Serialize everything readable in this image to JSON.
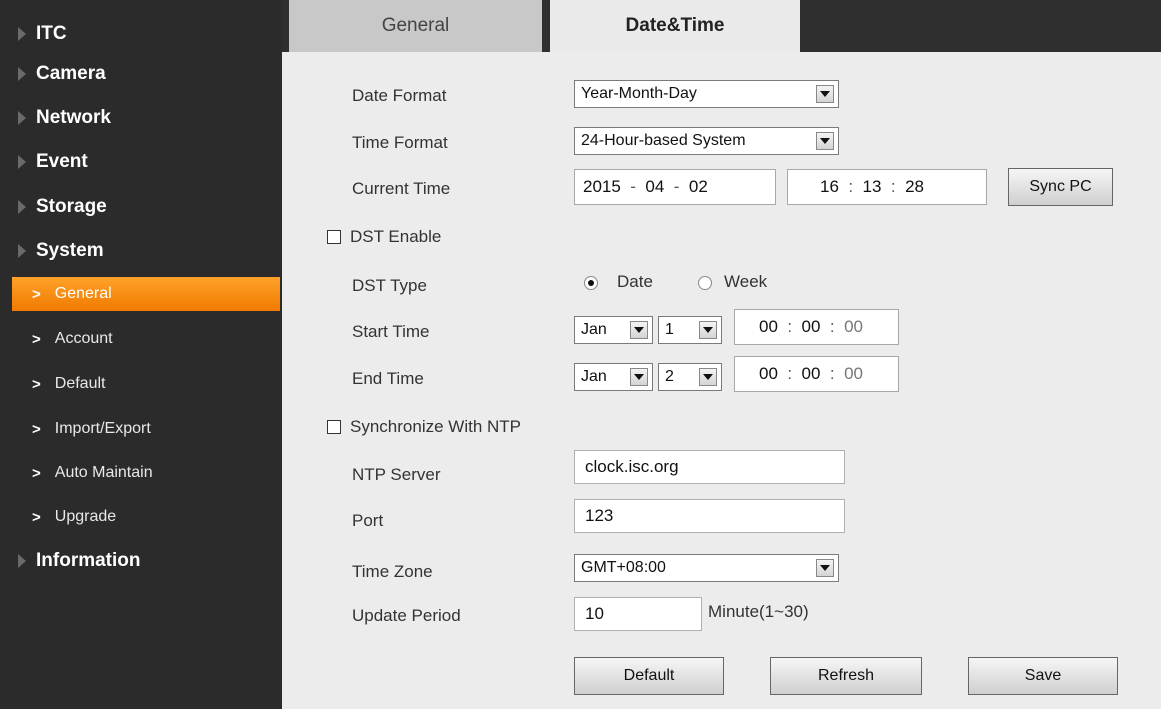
{
  "sidebar": {
    "top_items": [
      {
        "label": "ITC"
      },
      {
        "label": "Camera"
      },
      {
        "label": "Network"
      },
      {
        "label": "Event"
      },
      {
        "label": "Storage"
      },
      {
        "label": "System"
      },
      {
        "label": "Information"
      }
    ],
    "system_sub_items": [
      {
        "label": "General",
        "active": true
      },
      {
        "label": "Account"
      },
      {
        "label": "Default"
      },
      {
        "label": "Import/Export"
      },
      {
        "label": "Auto Maintain"
      },
      {
        "label": "Upgrade"
      }
    ],
    "active_color": "#f7901e"
  },
  "tabs": [
    {
      "label": "General",
      "active": false
    },
    {
      "label": "Date&Time",
      "active": true
    }
  ],
  "form": {
    "date_format": {
      "label": "Date Format",
      "value": "Year-Month-Day"
    },
    "time_format": {
      "label": "Time Format",
      "value": "24-Hour-based System"
    },
    "current_time": {
      "label": "Current Time",
      "year": "2015",
      "month": "04",
      "day": "02",
      "hour": "16",
      "minute": "13",
      "second": "28",
      "sync_label": "Sync PC"
    },
    "dst_enable": {
      "label": "DST Enable",
      "checked": false
    },
    "dst_type": {
      "label": "DST Type",
      "options": [
        "Date",
        "Week"
      ],
      "selected": "Date"
    },
    "start_time": {
      "label": "Start Time",
      "month": "Jan",
      "day": "1",
      "hour": "00",
      "minute": "00",
      "second": "00"
    },
    "end_time": {
      "label": "End Time",
      "month": "Jan",
      "day": "2",
      "hour": "00",
      "minute": "00",
      "second": "00"
    },
    "ntp_sync": {
      "label": "Synchronize With NTP",
      "checked": false
    },
    "ntp_server": {
      "label": "NTP Server",
      "value": "clock.isc.org"
    },
    "port": {
      "label": "Port",
      "value": "123"
    },
    "time_zone": {
      "label": "Time Zone",
      "value": "GMT+08:00"
    },
    "update_period": {
      "label": "Update Period",
      "value": "10",
      "unit": "Minute(1~30)"
    }
  },
  "buttons": {
    "default": "Default",
    "refresh": "Refresh",
    "save": "Save"
  }
}
